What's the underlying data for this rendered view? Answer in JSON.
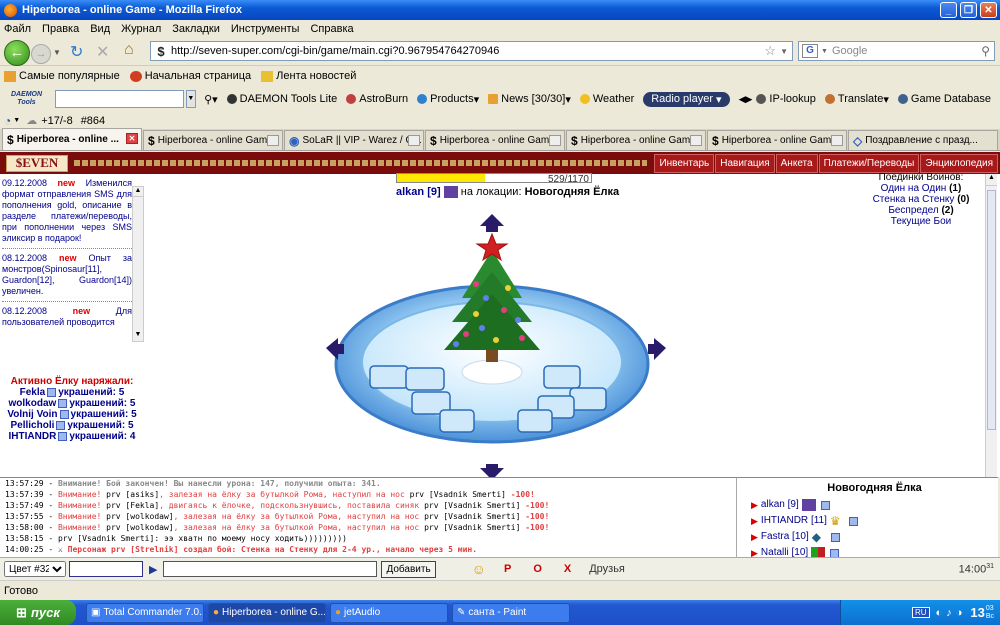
{
  "window": {
    "title": "Hiperborea - online Game - Mozilla Firefox"
  },
  "menu": [
    "Файл",
    "Правка",
    "Вид",
    "Журнал",
    "Закладки",
    "Инструменты",
    "Справка"
  ],
  "nav": {
    "url": "http://seven-super.com/cgi-bin/game/main.cgi?0.967954764270946",
    "search_placeholder": "Google"
  },
  "bookmarks": [
    "Самые популярные",
    "Начальная страница",
    "Лента новостей"
  ],
  "daemon": {
    "logo_top": "DAEMON",
    "logo_bottom": "Tools",
    "items": [
      "DAEMON Tools Lite",
      "AstroBurn",
      "Products",
      "News [30/30]",
      "Weather",
      "Radio player",
      "IP-lookup",
      "Translate",
      "Game Database"
    ]
  },
  "row2": {
    "temp": "+17/-8",
    "count": "#864"
  },
  "tabs": [
    {
      "label": "Hiperborea - online ...",
      "active": true
    },
    {
      "label": "Hiperborea - online Game",
      "active": false
    },
    {
      "label": "SoLaR || VIP - Warez / G...",
      "active": false
    },
    {
      "label": "Hiperborea - online Game",
      "active": false
    },
    {
      "label": "Hiperborea - online Game",
      "active": false
    },
    {
      "label": "Hiperborea - online Game",
      "active": false
    },
    {
      "label": "Поздравление с празд...",
      "active": false
    }
  ],
  "game": {
    "logo": "$EVEN",
    "nav": [
      "Инвентарь",
      "Навигация",
      "Анкета",
      "Платежи/Переводы",
      "Энциклопедия"
    ],
    "hp": {
      "current": 529,
      "max": 1170,
      "text": "529/1170"
    },
    "player": {
      "name": "alkan",
      "level": "[9]"
    },
    "location_label": "на локации:",
    "location_name": "Новогодняя Ёлка",
    "fights": {
      "title": "Поединки Воинов:",
      "items": [
        {
          "label": "Один на Один",
          "count": "(1)"
        },
        {
          "label": "Стенка на Стенку",
          "count": "(0)"
        },
        {
          "label": "Беспредел",
          "count": "(2)"
        },
        {
          "label": "Текущие Бои",
          "count": ""
        }
      ]
    },
    "news": [
      {
        "date": "09.12.2008",
        "tag": "new",
        "text": "Изменился формат отправления SMS для пополнения gold, описание в разделе платежи/переводы, при пополнении через SMS эликсир в подарок!"
      },
      {
        "date": "08.12.2008",
        "tag": "new",
        "text": "Опыт за монстров(Spinosaur[11], Guardon[12], Guardon[14]) увеличен."
      },
      {
        "date": "08.12.2008",
        "tag": "new",
        "text": "Для пользователей проводится"
      }
    ],
    "decorators": {
      "title": "Активно Ёлку наряжали:",
      "label": "украшений:",
      "items": [
        {
          "name": "Fekla",
          "count": "5"
        },
        {
          "name": "wolkodaw",
          "count": "5"
        },
        {
          "name": "Volnij Voin",
          "count": "5"
        },
        {
          "name": "Pellicholi",
          "count": "5"
        },
        {
          "name": "IHTIANDR",
          "count": "4"
        }
      ]
    }
  },
  "chat": [
    {
      "time": "13:57:29",
      "text": "Внимание! Бой закончен! Вы нанесли урона: 147, получили опыта: 341.",
      "kind": "gray"
    },
    {
      "time": "13:57:39",
      "warn": "Внимание!",
      "who": "prv [asiks]",
      "text": ", залезая на ёлку за бутылкой Рома, наступил на нос",
      "target": "prv [Vsadnik Smerti]",
      "dmg": "-100!"
    },
    {
      "time": "13:57:49",
      "warn": "Внимание!",
      "who": "prv [Fekla]",
      "text": ", двигаясь к ёлочке, подскользнувшись, поставила синяк",
      "target": "prv [Vsadnik Smerti]",
      "dmg": "-100!"
    },
    {
      "time": "13:57:55",
      "warn": "Внимание!",
      "who": "prv [wolkodaw]",
      "text": ", залезая на ёлку за бутылкой Рома, наступил на нос",
      "target": "prv [Vsadnik Smerti]",
      "dmg": "-100!"
    },
    {
      "time": "13:58:00",
      "warn": "Внимание!",
      "who": "prv [wolkodaw]",
      "text": ", залезая на ёлку за бутылкой Рома, наступил на нос",
      "target": "prv [Vsadnik Smerti]",
      "dmg": "-100!"
    },
    {
      "time": "13:58:15",
      "who": "prv [Vsadnik Smerti]",
      "text": ": ээ хватн по моему носу ходить)))))))))",
      "kind": "talk"
    },
    {
      "time": "14:00:25",
      "text": "Персонаж prv [Strelnik] создал бой: Стенка на Стенку для 2-4 ур., начало через 5 мин.",
      "kind": "event"
    }
  ],
  "location_panel": {
    "title": "Новогодняя Ёлка",
    "players": [
      {
        "name": "alkan",
        "level": "[9]"
      },
      {
        "name": "IHTIANDR",
        "level": "[11]"
      },
      {
        "name": "Fastra",
        "level": "[10]"
      },
      {
        "name": "Natalli",
        "level": "[10]"
      }
    ]
  },
  "chatbar": {
    "color_select": "Цвет #32",
    "send_label": "Добавить",
    "p": "P",
    "o": "O",
    "x": "X",
    "friends": "Друзья",
    "time": "14:00",
    "sup": "31"
  },
  "status": "Готово",
  "taskbar": {
    "start": "пуск",
    "tasks": [
      "Total Commander 7.0...",
      "Hiperborea - online G...",
      "jetAudio",
      "санта - Paint"
    ],
    "lang": "RU",
    "clock": "13",
    "clock_sub": "03",
    "day": "Вс"
  },
  "colors": {
    "game_header": "#7a0c0c",
    "player_link": "#00008b",
    "warn_red": "#e04040"
  }
}
